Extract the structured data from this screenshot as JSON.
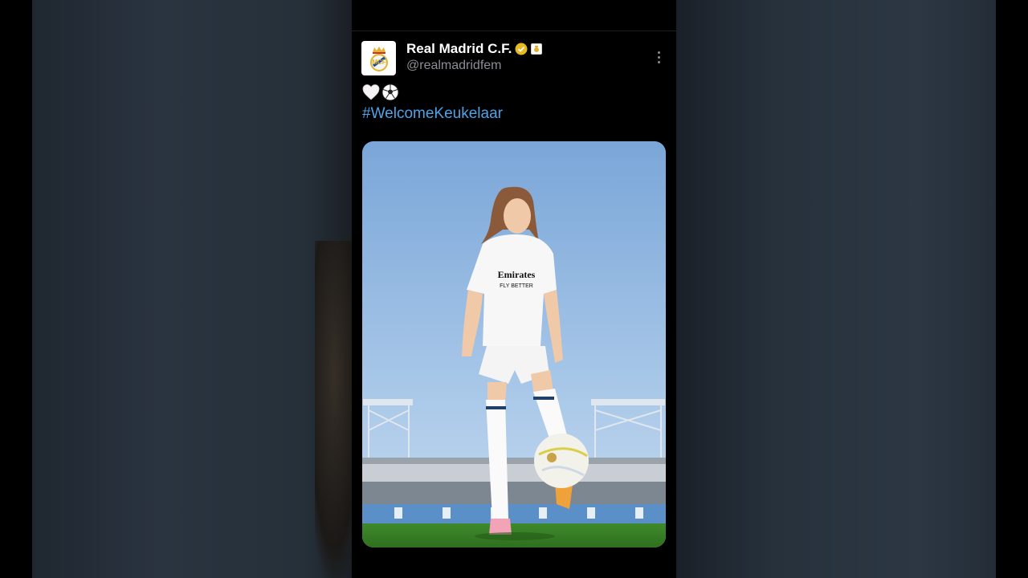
{
  "tweet": {
    "display_name": "Real Madrid C.F.",
    "handle": "@realmadridfem",
    "emojis": "🤍⚽",
    "hashtag": "#WelcomeKeukelaar",
    "shirt_sponsor_line1": "Emirates",
    "shirt_sponsor_line2": "FLY BETTER"
  },
  "colors": {
    "hashtag": "#4da3e8",
    "verified": "#e8b923",
    "background": "#000000"
  },
  "icons": {
    "avatar": "real-madrid-crest-icon",
    "verified": "gold-verified-badge-icon",
    "affiliate": "affiliate-crest-badge-icon",
    "more": "more-vertical-icon"
  }
}
